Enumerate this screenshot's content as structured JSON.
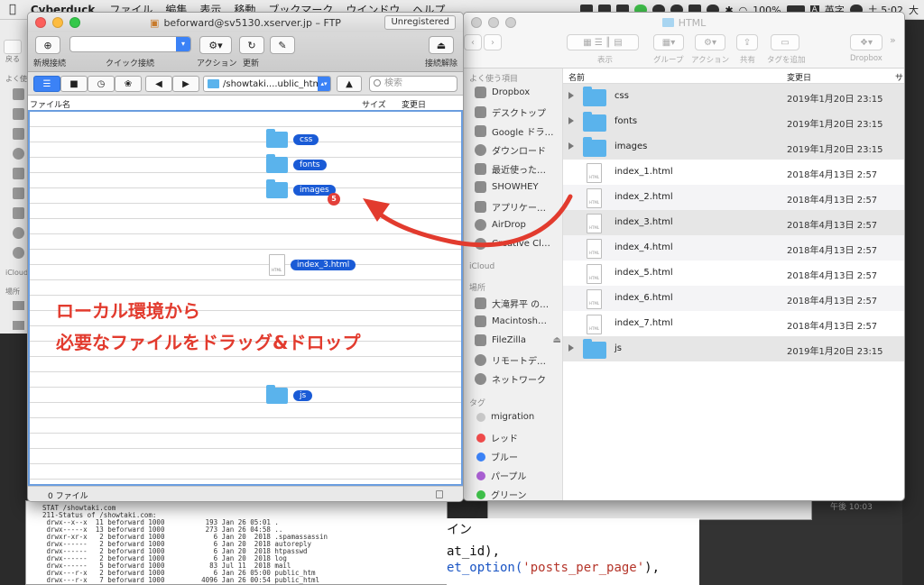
{
  "menubar": {
    "app_name": "Cyberduck",
    "items": [
      "ファイル",
      "編集",
      "表示",
      "移動",
      "ブックマーク",
      "ウインドウ",
      "ヘルプ"
    ],
    "battery": "100%",
    "input": "英字",
    "input_badge": "A",
    "clock": "土 5:02",
    "user_short": "大"
  },
  "cyberduck": {
    "title": "beforward@sv5130.xserver.jp – FTP",
    "unregistered": "Unregistered",
    "toolbar": {
      "new_connection": "新規接続",
      "quick_connect": "クイック接続",
      "action": "アクション",
      "refresh": "更新",
      "edit": "",
      "disconnect": "接続解除"
    },
    "path": "/showtaki....ublic_htm",
    "search_placeholder": "検索",
    "columns": {
      "name": "ファイル名",
      "size": "サイズ",
      "modified": "変更日"
    },
    "status": "0 ファイル",
    "drag_items": [
      {
        "name": "css",
        "kind": "folder"
      },
      {
        "name": "fonts",
        "kind": "folder"
      },
      {
        "name": "images",
        "kind": "folder",
        "badge": "5"
      },
      {
        "name": "index_3.html",
        "kind": "file"
      },
      {
        "name": "js",
        "kind": "folder"
      }
    ]
  },
  "annotation": {
    "line1": "ローカル環境から",
    "line2": "必要なファイルをドラッグ&ドロップ",
    "color": "#e23b2e"
  },
  "finder": {
    "title": "HTML",
    "toolbar": {
      "back_label": "戻る/進む",
      "view": "表示",
      "group": "グループ",
      "action": "アクション",
      "share": "共有",
      "tag": "タグを追加",
      "dropbox": "Dropbox"
    },
    "sidebar": {
      "favorites_header": "よく使う項目",
      "favorites": [
        "Dropbox",
        "デスクトップ",
        "Google ドラ…",
        "ダウンロード",
        "最近使った…",
        "SHOWHEY",
        "アプリケー…",
        "AirDrop",
        "Creative Cl…"
      ],
      "icloud_header": "iCloud",
      "places_header": "場所",
      "places": [
        "大滝昇平 の…",
        "Macintosh…",
        "FileZilla",
        "リモートデ…",
        "ネットワーク"
      ],
      "tags_header": "タグ",
      "tags": [
        {
          "name": "migration",
          "color": "#c8c8c8"
        },
        {
          "name": "レッド",
          "color": "#ef4b4b"
        },
        {
          "name": "ブルー",
          "color": "#3b82f6"
        },
        {
          "name": "パープル",
          "color": "#a85fd1"
        },
        {
          "name": "グリーン",
          "color": "#3fbf4a"
        }
      ]
    },
    "columns": {
      "name": "名前",
      "modified": "変更日",
      "size": "サ"
    },
    "files": [
      {
        "name": "css",
        "date": "2019年1月20日 23:15",
        "kind": "folder"
      },
      {
        "name": "fonts",
        "date": "2019年1月20日 23:15",
        "kind": "folder"
      },
      {
        "name": "images",
        "date": "2019年1月20日 23:15",
        "kind": "folder"
      },
      {
        "name": "index_1.html",
        "date": "2018年4月13日 2:57",
        "kind": "file"
      },
      {
        "name": "index_2.html",
        "date": "2018年4月13日 2:57",
        "kind": "file"
      },
      {
        "name": "index_3.html",
        "date": "2018年4月13日 2:57",
        "kind": "file"
      },
      {
        "name": "index_4.html",
        "date": "2018年4月13日 2:57",
        "kind": "file"
      },
      {
        "name": "index_5.html",
        "date": "2018年4月13日 2:57",
        "kind": "file"
      },
      {
        "name": "index_6.html",
        "date": "2018年4月13日 2:57",
        "kind": "file"
      },
      {
        "name": "index_7.html",
        "date": "2018年4月13日 2:57",
        "kind": "file"
      },
      {
        "name": "js",
        "date": "2019年1月20日 23:15",
        "kind": "folder"
      }
    ]
  },
  "left_finder": {
    "back_label": "戻る",
    "fav_header": "よく使",
    "icloud": "iCloud",
    "places": "場所"
  },
  "terminal": {
    "lines": [
      "STAT /showtaki.com",
      "211-Status of /showtaki.com:",
      " drwx--x--x  11 beforward 1000          193 Jan 26 05:01 .",
      " drwx-----x  13 beforward 1000          273 Jan 26 04:58 ..",
      " drwxr-xr-x   2 beforward 1000            6 Jan 20  2018 .spamassassin",
      " drwx------   2 beforward 1000            6 Jan 20  2018 autoreply",
      " drwx------   2 beforward 1000            6 Jan 20  2018 htpasswd",
      " drwx------   2 beforward 1000            6 Jan 20  2018 log",
      " drwx------   5 beforward 1000           83 Jul 11  2018 mail",
      " drwx---r-x   2 beforward 1000            6 Jan 26 05:00 public_htm",
      " drwx---r-x   7 beforward 1000         4096 Jan 26 00:54 public_html"
    ]
  },
  "code": {
    "line1": "イン",
    "line2": "at_id),",
    "line3_a": "et_option(",
    "line3_b": "'posts_per_page'",
    "line3_c": "),"
  },
  "bg_time": "午後 10:03"
}
